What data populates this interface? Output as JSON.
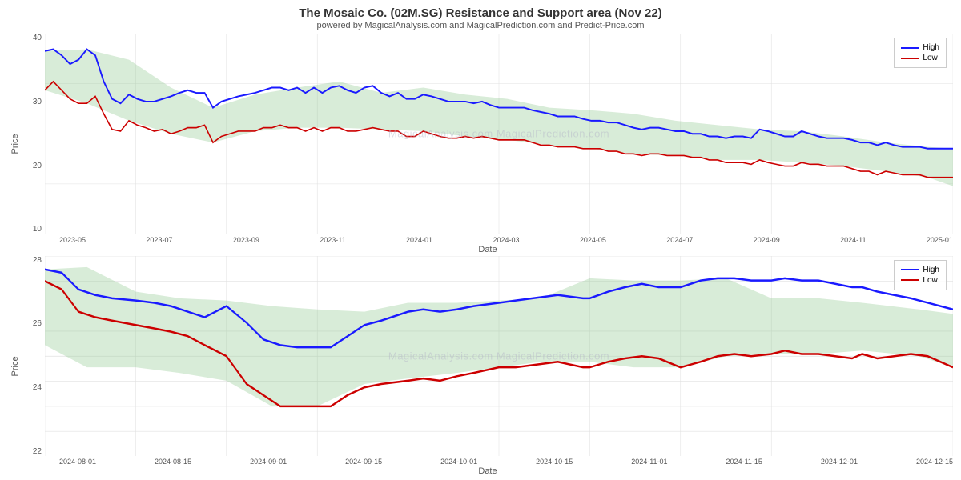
{
  "page": {
    "title": "The Mosaic Co. (02M.SG) Resistance and Support area (Nov 22)",
    "subtitle": "powered by MagicalAnalysis.com and MagicalPrediction.com and Predict-Price.com"
  },
  "chart1": {
    "y_label": "Price",
    "x_label": "Date",
    "y_ticks": [
      "40",
      "30",
      "20",
      "10"
    ],
    "x_ticks": [
      "2023-05",
      "2023-07",
      "2023-09",
      "2023-11",
      "2024-01",
      "2024-03",
      "2024-05",
      "2024-07",
      "2024-09",
      "2024-11",
      "2025-01"
    ],
    "legend": {
      "high_label": "High",
      "low_label": "Low"
    },
    "watermark": "MagicalAnalysis.com   MagicalPrediction.com"
  },
  "chart2": {
    "y_label": "Price",
    "x_label": "Date",
    "y_ticks": [
      "28",
      "26",
      "24",
      "22"
    ],
    "x_ticks": [
      "2024-08-01",
      "2024-08-15",
      "2024-09-01",
      "2024-09-15",
      "2024-10-01",
      "2024-10-15",
      "2024-11-01",
      "2024-11-15",
      "2024-12-01",
      "2024-12-15"
    ],
    "legend": {
      "high_label": "High",
      "low_label": "Low"
    },
    "watermark": "MagicalAnalysis.com   MagicalPrediction.com"
  },
  "colors": {
    "high_line": "#1a1aff",
    "low_line": "#cc0000",
    "band_fill": "rgba(144,200,144,0.35)",
    "grid": "#e0e0e0"
  }
}
